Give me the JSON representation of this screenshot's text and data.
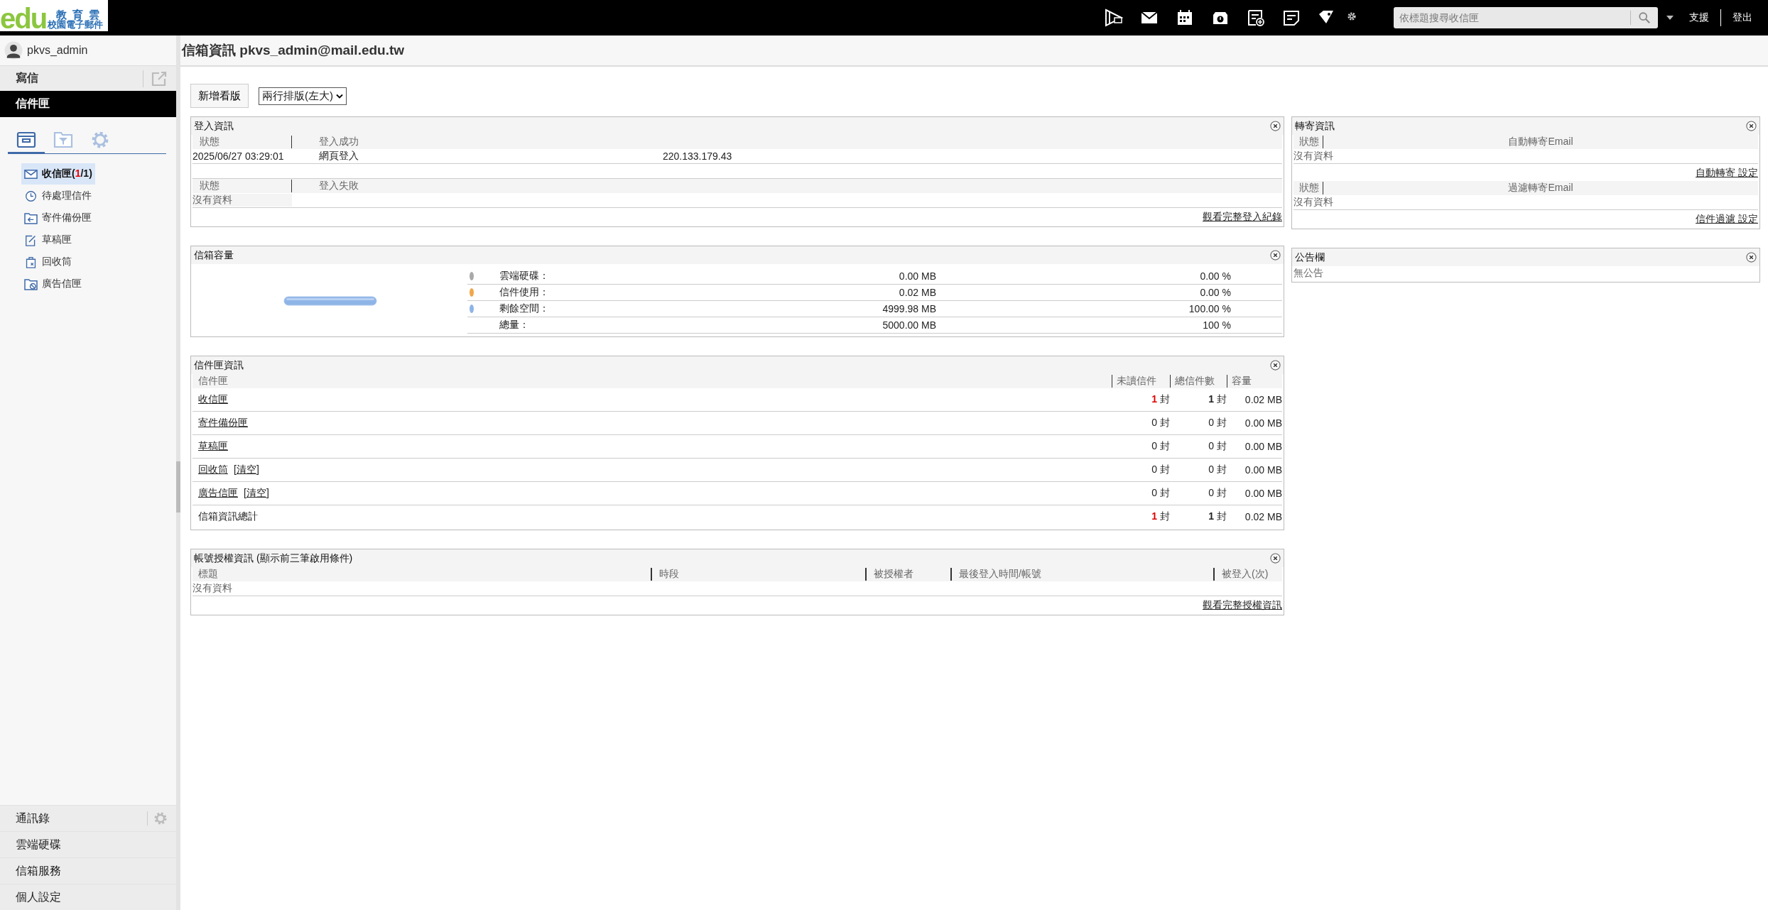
{
  "logo": {
    "brand": "edu",
    "name": "教育雲",
    "subtitle": "校園電子郵件"
  },
  "topbar": {
    "search": {
      "placeholder": "依標題搜尋收信匣"
    },
    "links": [
      "支援",
      "登出"
    ]
  },
  "user": {
    "name": "pkvs_admin"
  },
  "sidebar": {
    "compose": "寫信",
    "section": "信件匣",
    "tabs": [
      {
        "kind": "folders",
        "selected": true
      },
      {
        "kind": "filter",
        "selected": false
      },
      {
        "kind": "settings",
        "selected": false
      }
    ],
    "folders": [
      {
        "kind": "inbox",
        "label": "收信匣(",
        "unread": "1",
        "rest": "/1)",
        "selected": true
      },
      {
        "kind": "pending",
        "label": "待處理信件",
        "selected": false
      },
      {
        "kind": "sent",
        "label": "寄件備份匣",
        "selected": false
      },
      {
        "kind": "drafts",
        "label": "草稿匣",
        "selected": false
      },
      {
        "kind": "trash",
        "label": "回收筒",
        "selected": false
      },
      {
        "kind": "spam",
        "label": "廣告信匣",
        "selected": false
      }
    ],
    "bottom": [
      {
        "label": "通訊錄",
        "has_settings": true
      },
      {
        "label": "雲端硬碟",
        "has_settings": false
      },
      {
        "label": "信箱服務",
        "has_settings": false
      },
      {
        "label": "個人設定",
        "has_settings": false
      }
    ]
  },
  "main": {
    "title": "信箱資訊 pkvs_admin@mail.edu.tw",
    "add_button": "新增看版",
    "layout_select": "兩行排版(左大)"
  },
  "login_panel": {
    "title": "登入資訊",
    "success_headers": [
      "狀態",
      "登入成功"
    ],
    "success_rows": [
      [
        "2025/06/27 03:29:01",
        "網頁登入",
        "220.133.179.43"
      ]
    ],
    "failure_headers": [
      "狀態",
      "登入失敗"
    ],
    "failure_empty": "沒有資料",
    "link": "觀看完整登入紀錄"
  },
  "capacity_panel": {
    "title": "信箱容量",
    "rows": [
      {
        "label": "雲端硬碟：",
        "size": "0.00 MB",
        "percent": "0.00 %",
        "color": "#a9a9a9"
      },
      {
        "label": "信件使用：",
        "size": "0.02 MB",
        "percent": "0.00 %",
        "color": "#f0a64a"
      },
      {
        "label": "剩餘空間：",
        "size": "4999.98 MB",
        "percent": "100.00 %",
        "color": "#8fb4e6"
      },
      {
        "label": "總量：",
        "size": "5000.00 MB",
        "percent": "100 %"
      }
    ]
  },
  "folder_panel": {
    "title": "信件匣資訊",
    "columns": [
      "信件匣",
      "未讀信件",
      "總信件數",
      "容量"
    ],
    "rows": [
      {
        "name": "收信匣",
        "link": true,
        "unread": "1",
        "unit": "封",
        "unread_alert": true,
        "total": "**1** 封",
        "size": "0.02 MB"
      },
      {
        "name": "寄件備份匣",
        "link": true,
        "unread": "0",
        "unit": "封",
        "unread_alert": false,
        "total": "0 封",
        "size": "0.00 MB"
      },
      {
        "name": "草稿匣",
        "link": true,
        "unread": "0",
        "unit": "封",
        "unread_alert": false,
        "total": "0 封",
        "size": "0.00 MB"
      },
      {
        "name": "回收筒",
        "link": true,
        "clear": "[清空]",
        "unread": "0",
        "unit": "封",
        "unread_alert": false,
        "total": "0 封",
        "size": "0.00 MB"
      },
      {
        "name": "廣告信匣",
        "link": true,
        "clear": "[清空]",
        "unread": "0",
        "unit": "封",
        "unread_alert": false,
        "total": "0 封",
        "size": "0.00 MB"
      },
      {
        "name": "信箱資訊總計",
        "link": false,
        "unread": "1",
        "unit": "封",
        "unread_alert": true,
        "total": "**1** 封",
        "size": "0.02 MB"
      }
    ]
  },
  "auth_panel": {
    "title": "帳號授權資訊 (顯示前三筆啟用條件)",
    "columns": [
      "標題",
      "時段",
      "被授權者",
      "最後登入時間/帳號",
      "被登入(次)"
    ],
    "empty": "沒有資料",
    "link": "觀看完整授權資訊"
  },
  "forward_panel": {
    "title": "轉寄資訊",
    "sections": [
      {
        "headers": [
          "狀態",
          "自動轉寄Email"
        ],
        "empty": "沒有資料",
        "link": "自動轉寄 設定"
      },
      {
        "headers": [
          "狀態",
          "過濾轉寄Email"
        ],
        "empty": "沒有資料",
        "link": "信件過濾 設定"
      }
    ]
  },
  "notice_panel": {
    "title": "公告欄",
    "text": "無公告"
  }
}
